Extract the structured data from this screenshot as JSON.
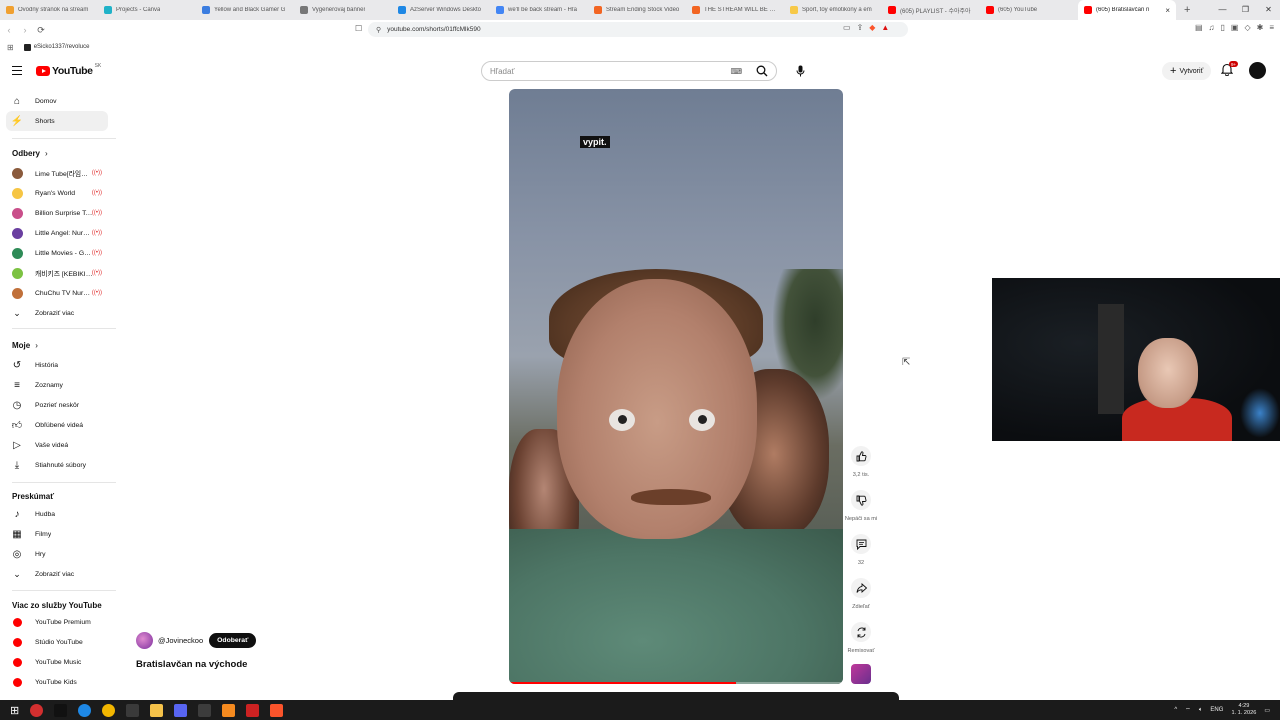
{
  "browser": {
    "tabs": [
      {
        "title": "Ovodný stránok na stream",
        "color": "#f0a030"
      },
      {
        "title": "Projects - Canva",
        "color": "#20b2c8"
      },
      {
        "title": "Yellow and Black Gamer G",
        "color": "#3b7de0"
      },
      {
        "title": "Vygenerovaj banner",
        "color": "#777777"
      },
      {
        "title": "AzServer Windows Deskto",
        "color": "#1e88e5"
      },
      {
        "title": "we'll be back stream - Hľa",
        "color": "#4285f4"
      },
      {
        "title": "Stream Ending Stock Video",
        "color": "#f26522"
      },
      {
        "title": "THE STREAM WILL BE END",
        "color": "#f26522"
      },
      {
        "title": "Sport, toy emotikony a em",
        "color": "#f7c948"
      },
      {
        "title": "(605) PLAYLIST - 수아주아",
        "color": "#ff0000"
      },
      {
        "title": "(605) YouTube",
        "color": "#ff0000"
      },
      {
        "title": "(605) Bratislavčan n",
        "color": "#ff0000"
      }
    ],
    "active_tab_close": "×",
    "new_tab": "+",
    "window_controls": [
      "—",
      "❐",
      "✕"
    ],
    "url": "youtube.com/shorts/01ffcMlk590",
    "bookmark": "eSicko1337/revoluce"
  },
  "masthead": {
    "logo_text": "YouTube",
    "country_code": "SK",
    "search_placeholder": "Hľadať",
    "create_label": "Vytvoriť",
    "notification_count": "9+"
  },
  "sidebar": {
    "main": [
      {
        "label": "Domov",
        "icon": "home-icon"
      },
      {
        "label": "Shorts",
        "icon": "shorts-icon",
        "active": true
      }
    ],
    "subscriptions_title": "Odbery",
    "subscriptions": [
      {
        "label": "Lime Tube[라임튜브]",
        "color": "#8a5a3c"
      },
      {
        "label": "Ryan's World",
        "color": "#f6c544"
      },
      {
        "label": "Billion Surprise Toys",
        "color": "#c94f8a"
      },
      {
        "label": "Little Angel: Nursery",
        "color": "#6a3fa0"
      },
      {
        "label": "Little Movies - Games",
        "color": "#2e8b57"
      },
      {
        "label": "캐비키즈 [KEBIKIDS]",
        "color": "#7cc242"
      },
      {
        "label": "ChuChu TV Nursery",
        "color": "#c0703a"
      }
    ],
    "show_more": "Zobraziť viac",
    "you_title": "Moje",
    "you": [
      {
        "label": "História",
        "icon": "history-icon"
      },
      {
        "label": "Zoznamy",
        "icon": "playlists-icon"
      },
      {
        "label": "Pozrieť neskôr",
        "icon": "watch-later-icon"
      },
      {
        "label": "Obľúbené videá",
        "icon": "liked-videos-icon"
      },
      {
        "label": "Vaše videá",
        "icon": "your-videos-icon"
      },
      {
        "label": "Stiahnuté súbory",
        "icon": "downloads-icon"
      }
    ],
    "explore_title": "Preskúmať",
    "explore": [
      {
        "label": "Hudba",
        "icon": "music-icon"
      },
      {
        "label": "Filmy",
        "icon": "movies-icon"
      },
      {
        "label": "Hry",
        "icon": "gaming-icon"
      }
    ],
    "explore_more": "Zobraziť viac",
    "more_title": "Viac zo služby YouTube",
    "more": [
      {
        "label": "YouTube Premium",
        "color": "#ff0000"
      },
      {
        "label": "Štúdio YouTube",
        "color": "#ff0000"
      },
      {
        "label": "YouTube Music",
        "color": "#ff0000"
      },
      {
        "label": "YouTube Kids",
        "color": "#ff0000"
      }
    ]
  },
  "short": {
    "caption": "vypit.",
    "progress": 0.68,
    "channel": "@Jovineckoo",
    "subscribe_label": "Odoberať",
    "title": "Bratislavčan na východe",
    "actions": [
      {
        "name": "like",
        "label": "3,2 tis.",
        "icon": "thumbs-up-icon"
      },
      {
        "name": "dislike",
        "label": "Nepáči sa mi",
        "icon": "thumbs-down-icon"
      },
      {
        "name": "comments",
        "label": "32",
        "icon": "comment-icon"
      },
      {
        "name": "share",
        "label": "Zdieľať",
        "icon": "share-icon"
      },
      {
        "name": "remix",
        "label": "Remixovať",
        "icon": "remix-icon"
      }
    ]
  },
  "taskbar": {
    "apps": [
      "#d32f2f",
      "#111111",
      "#1e88e5",
      "#f2b600",
      "#3a3a3a",
      "#f5c24a",
      "#5865f2",
      "#3c3c3c",
      "#f58a1f",
      "#cc2222",
      "#fb542b"
    ],
    "lang": "ENG",
    "time": "4:29",
    "date": "1. 1. 2026"
  }
}
